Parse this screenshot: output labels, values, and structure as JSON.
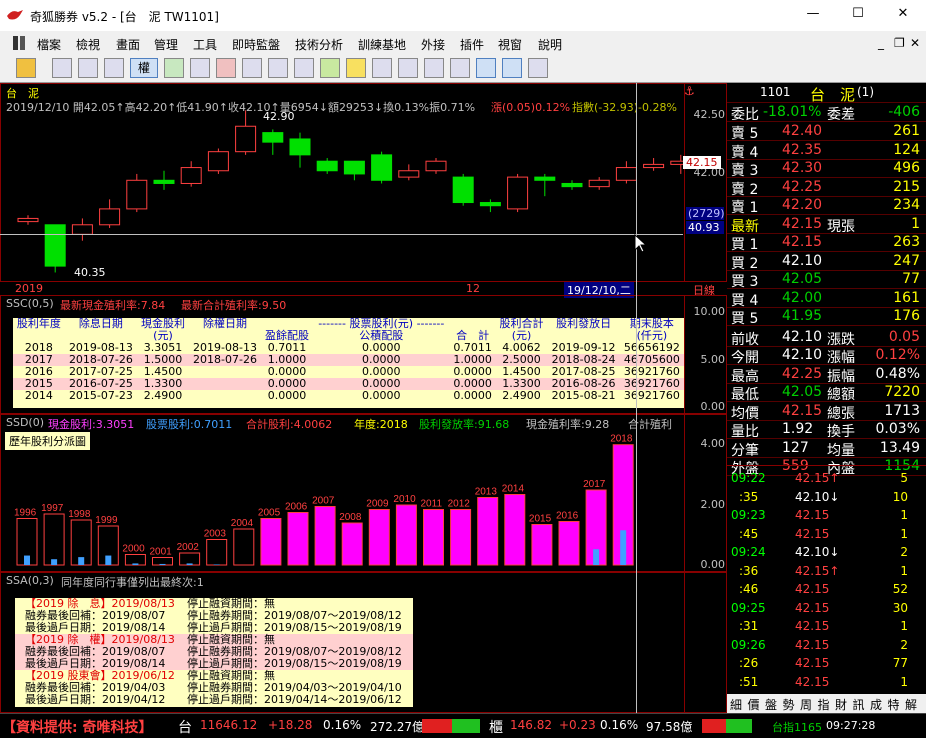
{
  "window": {
    "title": "奇狐勝券 v5.2 - [台　泥 TW1101]",
    "minimize": "—",
    "maximize": "☐",
    "close": "✕"
  },
  "menu": [
    "檔案",
    "檢視",
    "畫面",
    "管理",
    "工具",
    "即時監盤",
    "技術分析",
    "訓練基地",
    "外接",
    "插件",
    "視窗",
    "說明"
  ],
  "mdi": {
    "min": "_",
    "restore": "❐",
    "close": "✕"
  },
  "chart": {
    "stock_label": "台　泥",
    "info": "2019/12/10 開42.05↑高42.20↑低41.90↑收42.10↑量6954↓額29253↓換0.13%振0.71%",
    "change": "漲(0.05)0.12%",
    "index_change": "指數(-32.93)-0.28%",
    "alarm": "⚓",
    "y_ticks": [
      "42.50",
      "42.00"
    ],
    "price_tag": "42.15",
    "vol_tag": "(2729)",
    "vol_price": "40.93",
    "high_label": "42.90",
    "low_label": "40.35",
    "x_left": "2019",
    "x_mid": "12",
    "date_cursor": "19/12/10,二",
    "period": "日線",
    "candles": [
      {
        "o": 41.15,
        "c": 41.2,
        "h": 41.25,
        "l": 41.1
      },
      {
        "o": 41.1,
        "c": 40.45,
        "h": 41.1,
        "l": 40.35
      },
      {
        "o": 40.95,
        "c": 41.1,
        "h": 41.2,
        "l": 40.85
      },
      {
        "o": 41.1,
        "c": 41.35,
        "h": 41.5,
        "l": 41.05
      },
      {
        "o": 41.35,
        "c": 41.8,
        "h": 41.9,
        "l": 41.3
      },
      {
        "o": 41.8,
        "c": 41.75,
        "h": 41.95,
        "l": 41.65
      },
      {
        "o": 41.75,
        "c": 42.0,
        "h": 42.1,
        "l": 41.7
      },
      {
        "o": 41.95,
        "c": 42.25,
        "h": 42.3,
        "l": 41.9
      },
      {
        "o": 42.25,
        "c": 42.65,
        "h": 42.9,
        "l": 42.2
      },
      {
        "o": 42.55,
        "c": 42.4,
        "h": 42.6,
        "l": 42.2
      },
      {
        "o": 42.45,
        "c": 42.2,
        "h": 42.55,
        "l": 42.0
      },
      {
        "o": 42.1,
        "c": 41.95,
        "h": 42.15,
        "l": 41.9
      },
      {
        "o": 42.1,
        "c": 41.9,
        "h": 42.1,
        "l": 41.8
      },
      {
        "o": 42.2,
        "c": 41.8,
        "h": 42.25,
        "l": 41.75
      },
      {
        "o": 41.85,
        "c": 41.95,
        "h": 42.05,
        "l": 41.8
      },
      {
        "o": 41.95,
        "c": 42.1,
        "h": 42.15,
        "l": 41.9
      },
      {
        "o": 41.85,
        "c": 41.45,
        "h": 41.9,
        "l": 41.4
      },
      {
        "o": 41.45,
        "c": 41.4,
        "h": 41.5,
        "l": 41.3
      },
      {
        "o": 41.35,
        "c": 41.85,
        "h": 41.9,
        "l": 41.3
      },
      {
        "o": 41.85,
        "c": 41.8,
        "h": 41.9,
        "l": 41.55
      },
      {
        "o": 41.75,
        "c": 41.7,
        "h": 41.8,
        "l": 41.65
      },
      {
        "o": 41.7,
        "c": 41.8,
        "h": 41.85,
        "l": 41.65
      },
      {
        "o": 41.8,
        "c": 42.0,
        "h": 42.1,
        "l": 41.75
      },
      {
        "o": 42.0,
        "c": 42.05,
        "h": 42.15,
        "l": 41.95
      },
      {
        "o": 42.05,
        "c": 42.1,
        "h": 42.2,
        "l": 41.9
      }
    ]
  },
  "ssc": {
    "label": "SSC(0,5)",
    "yield": "最新現金殖利率:7.84",
    "total_yield": "最新合計殖利率:9.50",
    "y_ticks": [
      "10.00",
      "5.00",
      "0.00"
    ],
    "headers": [
      "股利年度",
      "除息日期",
      "現金股利\n(元)",
      "除權日期",
      "盈餘配股",
      "公積配股",
      "合　計",
      "股利合計\n(元)",
      "股利發放日",
      "期末股本\n(仟元)"
    ],
    "header_group": "------- 股票股利(元) -------",
    "rows": [
      [
        "2018",
        "2019-08-13",
        "3.3051",
        "2019-08-13",
        "0.7011",
        "0.0000",
        "0.7011",
        "4.0062",
        "2019-09-12",
        "56656192"
      ],
      [
        "2017",
        "2018-07-26",
        "1.5000",
        "2018-07-26",
        "1.0000",
        "0.0000",
        "1.0000",
        "2.5000",
        "2018-08-24",
        "46705600"
      ],
      [
        "2016",
        "2017-07-25",
        "1.4500",
        "",
        "0.0000",
        "0.0000",
        "0.0000",
        "1.4500",
        "2017-08-25",
        "36921760"
      ],
      [
        "2015",
        "2016-07-25",
        "1.3300",
        "",
        "0.0000",
        "0.0000",
        "0.0000",
        "1.3300",
        "2016-08-26",
        "36921760"
      ],
      [
        "2014",
        "2015-07-23",
        "2.4900",
        "",
        "0.0000",
        "0.0000",
        "0.0000",
        "2.4900",
        "2015-08-21",
        "36921760"
      ]
    ]
  },
  "ssd": {
    "label": "SSD(0)",
    "cash": "現金股利:3.3051",
    "stock": "股票股利:0.7011",
    "total": "合計股利:4.0062",
    "year": "年度:2018",
    "payout": "股利發放率:91.68",
    "cash_yield": "現金殖利率:9.28",
    "total_yield": "合計殖利",
    "title": "歷年股利分派圖",
    "y_ticks": [
      "4.00",
      "2.00",
      "0.00"
    ]
  },
  "chart_data": {
    "type": "bar",
    "categories": [
      "1996",
      "1997",
      "1998",
      "1999",
      "2000",
      "2001",
      "2002",
      "2003",
      "2004",
      "2005",
      "2006",
      "2007",
      "2008",
      "2009",
      "2010",
      "2011",
      "2012",
      "2013",
      "2014",
      "2015",
      "2016",
      "2017",
      "2018"
    ],
    "series": [
      {
        "name": "合計股利",
        "values": [
          1.55,
          1.7,
          1.5,
          1.3,
          0.35,
          0.25,
          0.4,
          0.85,
          1.2,
          1.55,
          1.75,
          1.95,
          1.4,
          1.85,
          2.0,
          1.85,
          1.85,
          2.25,
          2.35,
          1.35,
          1.45,
          2.5,
          4.01
        ]
      },
      {
        "name": "現金股利",
        "values": [
          0.9,
          0.55,
          0.75,
          0.9,
          0.15,
          0.1,
          0.15,
          0.05,
          0.0,
          0.0,
          0.0,
          0.0,
          0.0,
          0.0,
          0.0,
          0.0,
          0.0,
          0.0,
          0.0,
          0.0,
          0.0,
          1.5,
          3.31
        ]
      }
    ],
    "ylim": [
      0,
      4.4
    ]
  },
  "ssa": {
    "label": "SSA(0,3)",
    "desc": "同年度同行事僅列出最終次:1",
    "lines": [
      {
        "a": "【2019 除　息】2019/08/13",
        "b": "停止融資期間：無",
        "t": "h"
      },
      {
        "a": "融券最後回補：2019/08/07",
        "b": "停止融券期間：2019/08/07〜2019/08/12",
        "t": "n"
      },
      {
        "a": "最後過戶日期：2019/08/14",
        "b": "停止過戶期間：2019/08/15〜2019/08/19",
        "t": "n"
      },
      {
        "a": "【2019 除　權】2019/08/13",
        "b": "停止融資期間：無",
        "t": "h"
      },
      {
        "a": "融券最後回補：2019/08/07",
        "b": "停止融券期間：2019/08/07〜2019/08/12",
        "t": "n"
      },
      {
        "a": "最後過戶日期：2019/08/14",
        "b": "停止過戶期間：2019/08/15〜2019/08/19",
        "t": "n"
      },
      {
        "a": "【2019 股東會】2019/06/12",
        "b": "停止融資期間：無",
        "t": "h"
      },
      {
        "a": "融券最後回補：2019/04/03",
        "b": "停止融券期間：2019/04/03〜2019/04/10",
        "t": "n"
      },
      {
        "a": "最後過戶日期：2019/04/12",
        "b": "停止過戶期間：2019/04/14〜2019/06/12",
        "t": "n"
      }
    ]
  },
  "quote": {
    "code": "1101",
    "name": "台　泥",
    "suffix": "(1)",
    "weibi_label": "委比",
    "weibi": "-18.01%",
    "weicha_label": "委差",
    "weicha": "-406",
    "asks": [
      [
        "賣 5",
        "42.40",
        "261"
      ],
      [
        "賣 4",
        "42.35",
        "124"
      ],
      [
        "賣 3",
        "42.30",
        "496"
      ],
      [
        "賣 2",
        "42.25",
        "215"
      ],
      [
        "賣 1",
        "42.20",
        "234"
      ]
    ],
    "last": [
      "最新",
      "42.15",
      "現張",
      "1"
    ],
    "bids": [
      [
        "買 1",
        "42.15",
        "263"
      ],
      [
        "買 2",
        "42.10",
        "247"
      ],
      [
        "買 3",
        "42.05",
        "77"
      ],
      [
        "買 4",
        "42.00",
        "161"
      ],
      [
        "買 5",
        "41.95",
        "176"
      ]
    ],
    "stats": [
      [
        "前收",
        "42.10",
        "漲跌",
        "0.05"
      ],
      [
        "今開",
        "42.10",
        "漲幅",
        "0.12%"
      ],
      [
        "最高",
        "42.25",
        "振幅",
        "0.48%"
      ],
      [
        "最低",
        "42.05",
        "總額",
        "7220"
      ],
      [
        "均價",
        "42.15",
        "總張",
        "1713"
      ],
      [
        "量比",
        "1.92",
        "換手",
        "0.03%"
      ],
      [
        "分筆",
        "127",
        "均量",
        "13.49"
      ],
      [
        "外盤",
        "559",
        "內盤",
        "1154"
      ]
    ],
    "ticks": [
      [
        "09:22",
        "42.15↑",
        "5"
      ],
      [
        ":35",
        "42.10↓",
        "10"
      ],
      [
        "09:23",
        "42.15",
        "1"
      ],
      [
        ":45",
        "42.15",
        "1"
      ],
      [
        "09:24",
        "42.10↓",
        "2"
      ],
      [
        ":36",
        "42.15↑",
        "1"
      ],
      [
        ":46",
        "42.15",
        "52"
      ],
      [
        "09:25",
        "42.15",
        "30"
      ],
      [
        ":31",
        "42.15",
        "1"
      ],
      [
        "09:26",
        "42.15",
        "2"
      ],
      [
        ":26",
        "42.15",
        "77"
      ],
      [
        ":51",
        "42.15",
        "1"
      ]
    ],
    "tabs": [
      "細",
      "價",
      "盤",
      "勢",
      "周",
      "指",
      "財",
      "訊",
      "成",
      "特",
      "解"
    ]
  },
  "statusbar": {
    "provider": "【資料提供: 奇唯科技】",
    "tw_label": "台",
    "tw_index": "11646.12",
    "tw_change": "+18.28",
    "tw_pct": "0.16%",
    "tw_amt": "272.27億",
    "otc_label": "櫃",
    "otc_index": "146.82",
    "otc_change": "+0.23",
    "otc_pct": "0.16%",
    "otc_amt": "97.58億",
    "taizhi": "台指1165",
    "time": "09:27:28"
  },
  "colors": {
    "up": "#ff4040",
    "down": "#00d000",
    "flat": "#ffffff",
    "panel_border": "#800000"
  }
}
